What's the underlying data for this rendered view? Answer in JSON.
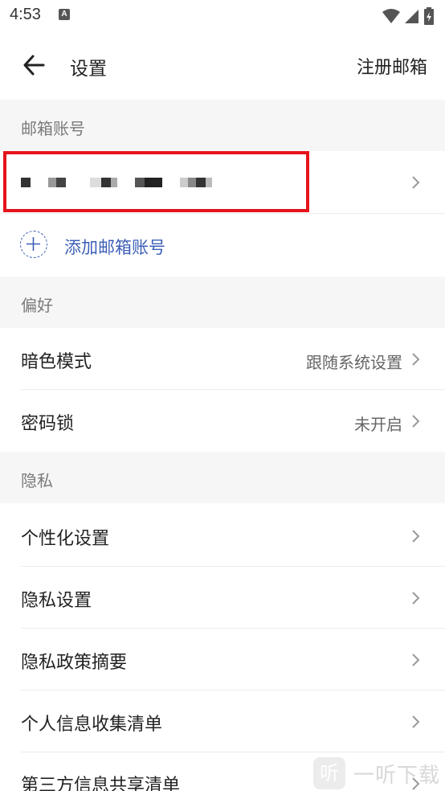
{
  "status_bar": {
    "time": "4:53",
    "notification_icon": "A",
    "icons": [
      "wifi-icon",
      "signal-icon",
      "battery-icon"
    ]
  },
  "header": {
    "title": "设置",
    "action_label": "注册邮箱",
    "back_icon": "arrow-left-icon"
  },
  "sections": {
    "accounts": {
      "title": "邮箱账号",
      "add_label": "添加邮箱账号"
    },
    "preferences": {
      "title": "偏好",
      "dark_mode": {
        "label": "暗色模式",
        "value": "跟随系统设置"
      },
      "passcode": {
        "label": "密码锁",
        "value": "未开启"
      }
    },
    "privacy": {
      "title": "隐私",
      "items": [
        {
          "label": "个性化设置"
        },
        {
          "label": "隐私设置"
        },
        {
          "label": "隐私政策摘要"
        },
        {
          "label": "个人信息收集清单"
        },
        {
          "label": "第三方信息共享清单"
        }
      ]
    }
  },
  "watermark": {
    "icon_char": "听",
    "text": "一听下载"
  },
  "colors": {
    "accent": "#3d5fb8",
    "highlight": "#e5141b",
    "section_bg": "#f6f6f6"
  }
}
